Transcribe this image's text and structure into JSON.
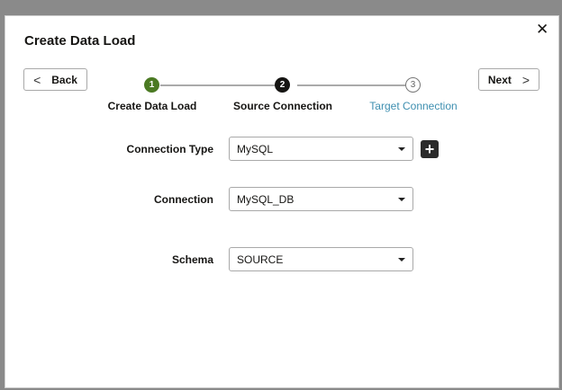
{
  "dialog": {
    "title": "Create Data Load",
    "close_icon": "close-icon"
  },
  "nav": {
    "back_label": "Back",
    "next_label": "Next"
  },
  "steps": [
    {
      "number": "1",
      "label": "Create Data Load",
      "state": "completed"
    },
    {
      "number": "2",
      "label": "Source Connection",
      "state": "current"
    },
    {
      "number": "3",
      "label": "Target Connection",
      "state": "upcoming"
    }
  ],
  "form": {
    "connection_type": {
      "label": "Connection Type",
      "value": "MySQL"
    },
    "connection": {
      "label": "Connection",
      "value": "MySQL_DB"
    },
    "schema": {
      "label": "Schema",
      "value": "SOURCE"
    }
  },
  "colors": {
    "completed": "#4b7a23",
    "current": "#161513",
    "link": "#3e8fb0"
  }
}
